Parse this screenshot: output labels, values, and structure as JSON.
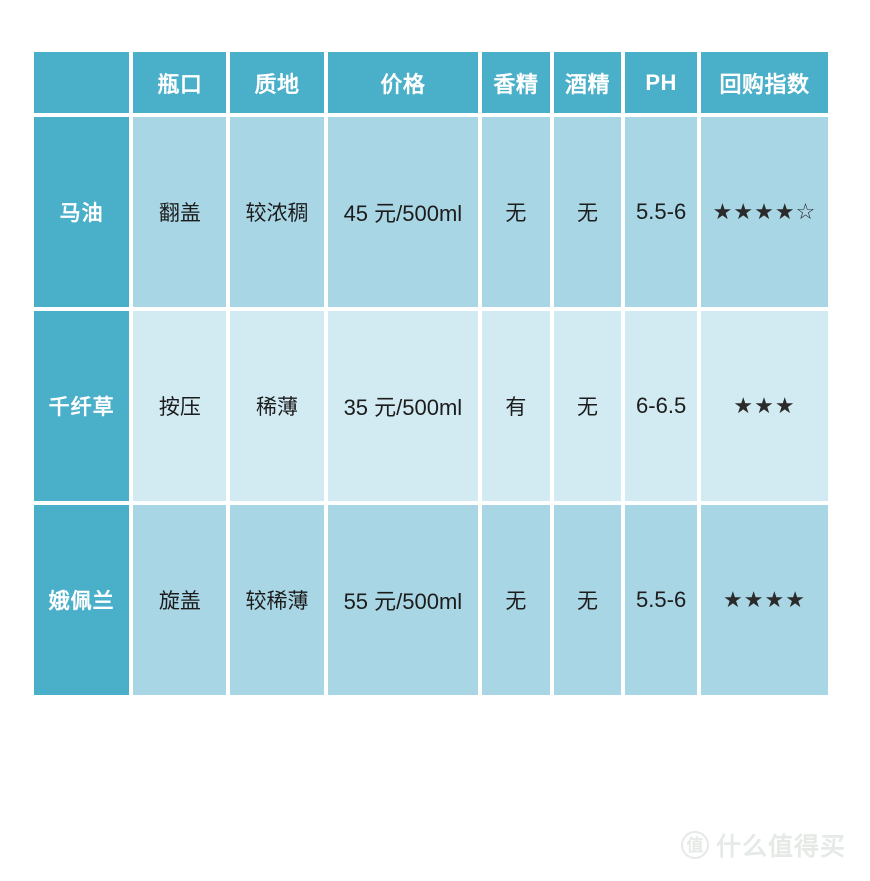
{
  "table": {
    "columns": [
      {
        "key": "label",
        "label": ""
      },
      {
        "key": "mouth",
        "label": "瓶口"
      },
      {
        "key": "text",
        "label": "质地"
      },
      {
        "key": "price",
        "label": "价格"
      },
      {
        "key": "frag",
        "label": "香精"
      },
      {
        "key": "alc",
        "label": "酒精"
      },
      {
        "key": "ph",
        "label": "PH"
      },
      {
        "key": "repeat",
        "label": "回购指数"
      }
    ],
    "rows": [
      {
        "label": "马油",
        "mouth": "翻盖",
        "texture": "较浓稠",
        "price": "45 元/500ml",
        "fragrance": "无",
        "alcohol": "无",
        "ph": "5.5-6",
        "rating_filled": 4,
        "rating_empty": 1,
        "rating_text": "★★★★☆"
      },
      {
        "label": "千纤草",
        "mouth": "按压",
        "texture": "稀薄",
        "price": "35 元/500ml",
        "fragrance": "有",
        "alcohol": "无",
        "ph": "6-6.5",
        "rating_filled": 3,
        "rating_empty": 0,
        "rating_text": "★★★"
      },
      {
        "label": "娥佩兰",
        "mouth": "旋盖",
        "texture": "较稀薄",
        "price": "55 元/500ml",
        "fragrance": "无",
        "alcohol": "无",
        "ph": "5.5-6",
        "rating_filled": 4,
        "rating_empty": 0,
        "rating_text": "★★★★"
      }
    ]
  },
  "watermark": {
    "badge": "值",
    "text": "什么值得买"
  },
  "colors": {
    "header": "#4aafc8",
    "row_dark": "#a9d6e5",
    "row_light": "#d2eaf2",
    "page_bg": "#ffffff",
    "header_text": "#ffffff",
    "cell_text": "#1c1c1c",
    "watermark": "#e6eae6"
  }
}
